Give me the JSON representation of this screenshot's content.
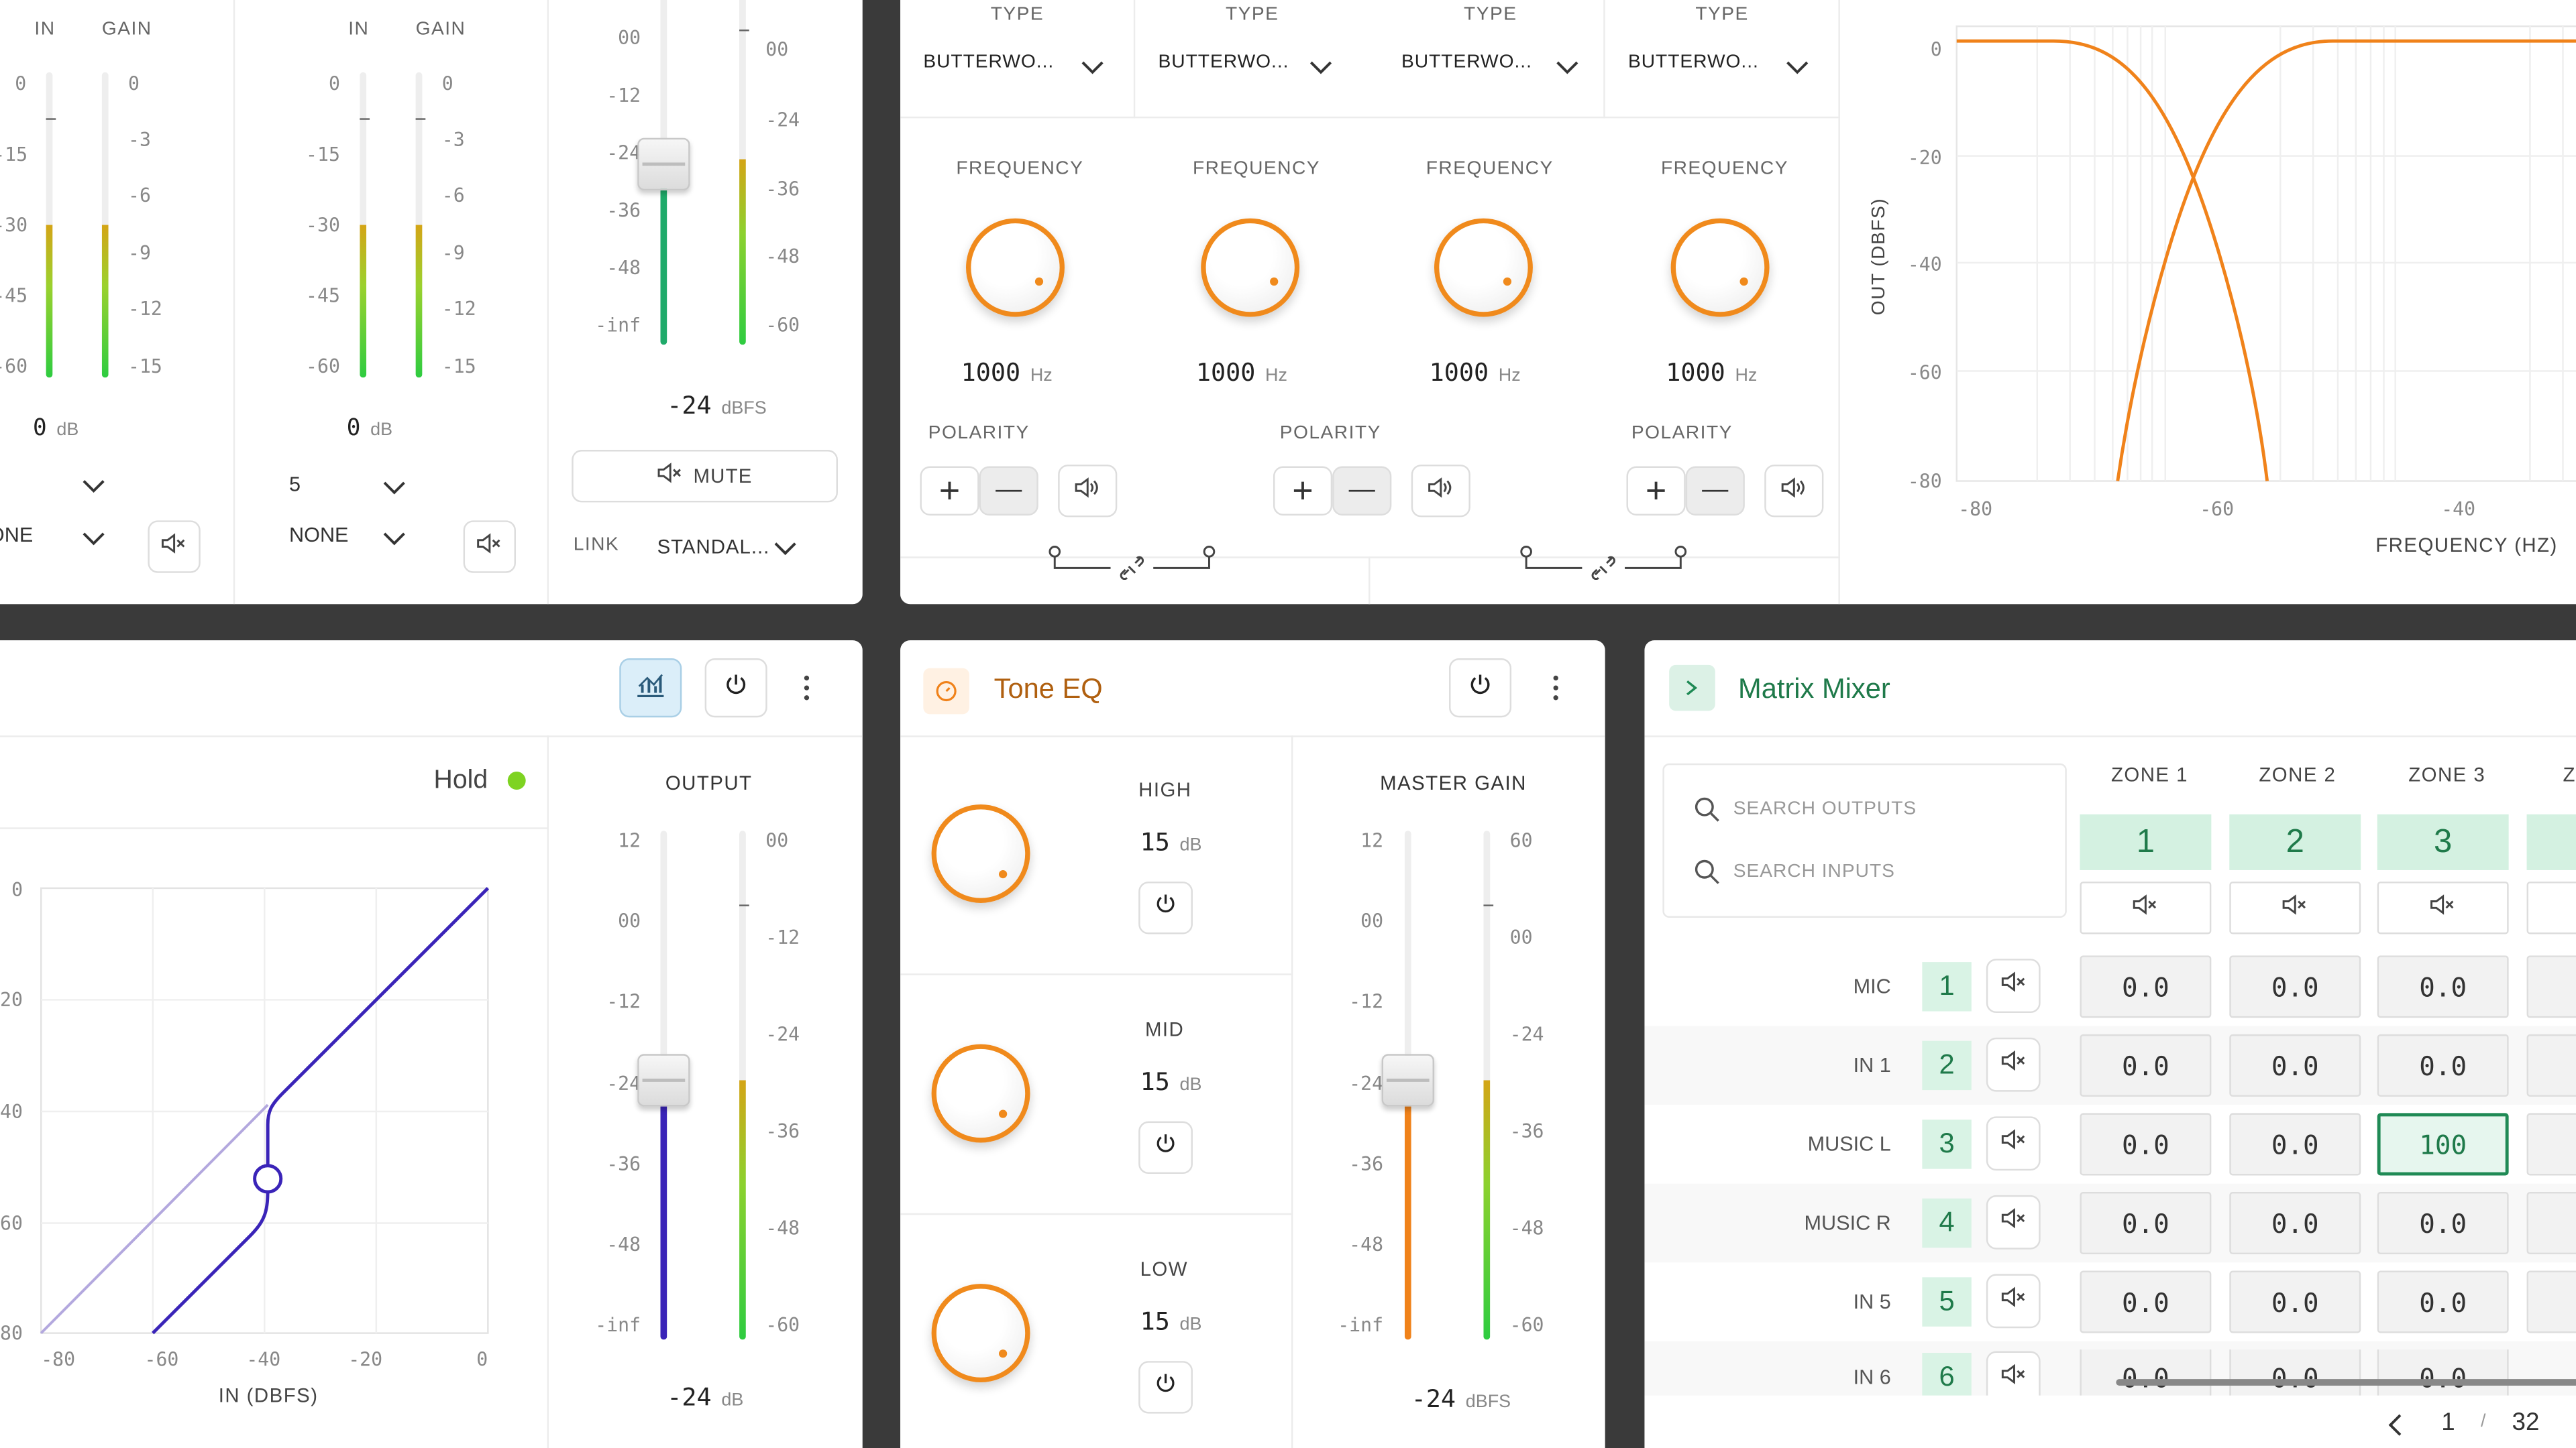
{
  "input_panel": {
    "ch1": {
      "in_label": "IN",
      "gain_label": "GAIN",
      "in_ticks": [
        "0",
        "-15",
        "-30",
        "-45",
        "-60"
      ],
      "gain_ticks": [
        "0",
        "-3",
        "-6",
        "-9",
        "-12",
        "-15"
      ],
      "db_value": "0",
      "db_unit": "dB",
      "dropdown_value": "",
      "mode_value": "NONE"
    },
    "ch2": {
      "in_label": "IN",
      "gain_label": "GAIN",
      "in_ticks": [
        "0",
        "-15",
        "-30",
        "-45",
        "-60"
      ],
      "gain_ticks": [
        "0",
        "-3",
        "-6",
        "-9",
        "-12",
        "-15"
      ],
      "db_value": "0",
      "db_unit": "dB",
      "dropdown_value": "5",
      "mode_value": "NONE"
    },
    "fader": {
      "left_ticks": [
        "00",
        "-12",
        "-24",
        "-36",
        "-48",
        "-inf"
      ],
      "right_ticks": [
        "00",
        "-24",
        "-36",
        "-48",
        "-60"
      ],
      "value": "-24",
      "unit": "dBFS",
      "mute_label": "MUTE",
      "link_label": "LINK",
      "link_value": "STANDAL..."
    }
  },
  "crossover_panel": {
    "bands": [
      {
        "type_label": "TYPE",
        "type_value": "BUTTERWO...",
        "freq_label": "FREQUENCY",
        "freq_value": "1000",
        "freq_unit": "Hz",
        "polarity_label": "POLARITY"
      },
      {
        "type_label": "TYPE",
        "type_value": "BUTTERWO...",
        "freq_label": "FREQUENCY",
        "freq_value": "1000",
        "freq_unit": "Hz",
        "polarity_label": "POLARITY"
      },
      {
        "type_label": "TYPE",
        "type_value": "BUTTERWO...",
        "freq_label": "FREQUENCY",
        "freq_value": "1000",
        "freq_unit": "Hz",
        "polarity_label": ""
      },
      {
        "type_label": "TYPE",
        "type_value": "BUTTERWO...",
        "freq_label": "FREQUENCY",
        "freq_value": "1000",
        "freq_unit": "Hz",
        "polarity_label": "POLARITY"
      }
    ],
    "plus_symbol": "+",
    "minus_symbol": "—"
  },
  "response_chart": {
    "ylabel": "OUT (DBFS)",
    "xlabel": "FREQUENCY (HZ)",
    "yticks": [
      "0",
      "-20",
      "-40",
      "-60",
      "-80"
    ],
    "xticks": [
      "-80",
      "-60",
      "-40"
    ],
    "accent": "#f0821a"
  },
  "compressor_panel": {
    "hold_label": "Hold",
    "hold_color": "#7ed321",
    "xlabel": "IN (DBFS)",
    "xticks": [
      "-80",
      "-60",
      "-40",
      "-20",
      "0"
    ],
    "yticks": [
      "0",
      "20",
      "40",
      "60",
      "80"
    ],
    "output_label": "OUTPUT",
    "out_left_ticks": [
      "12",
      "00",
      "-12",
      "-24",
      "-36",
      "-48",
      "-inf"
    ],
    "out_right_ticks": [
      "00",
      "-12",
      "-24",
      "-36",
      "-48",
      "-60"
    ],
    "out_value": "-24",
    "out_unit": "dB",
    "accent": "#3a24b8"
  },
  "tone_eq_panel": {
    "title": "Tone EQ",
    "bands": [
      {
        "label": "HIGH",
        "value": "15",
        "unit": "dB"
      },
      {
        "label": "MID",
        "value": "15",
        "unit": "dB"
      },
      {
        "label": "LOW",
        "value": "15",
        "unit": "dB"
      }
    ],
    "master_label": "MASTER GAIN",
    "left_ticks": [
      "12",
      "00",
      "-12",
      "-24",
      "-36",
      "-48",
      "-inf"
    ],
    "right_ticks": [
      "60",
      "00",
      "-24",
      "-36",
      "-48",
      "-60"
    ],
    "value": "-24",
    "unit": "dBFS",
    "accent": "#f0821a"
  },
  "matrix_panel": {
    "title": "Matrix Mixer",
    "search_outputs": "SEARCH OUTPUTS",
    "search_inputs": "SEARCH INPUTS",
    "zones": [
      {
        "label": "ZONE 1",
        "num": "1"
      },
      {
        "label": "ZONE 2",
        "num": "2"
      },
      {
        "label": "ZONE 3",
        "num": "3"
      }
    ],
    "zone4_partial": "Z",
    "rows": [
      {
        "label": "MIC",
        "num": "1",
        "cells": [
          "0.0",
          "0.0",
          "0.0"
        ]
      },
      {
        "label": "IN 1",
        "num": "2",
        "cells": [
          "0.0",
          "0.0",
          "0.0"
        ]
      },
      {
        "label": "MUSIC L",
        "num": "3",
        "cells": [
          "0.0",
          "0.0",
          "100"
        ]
      },
      {
        "label": "MUSIC R",
        "num": "4",
        "cells": [
          "0.0",
          "0.0",
          "0.0"
        ]
      },
      {
        "label": "IN 5",
        "num": "5",
        "cells": [
          "0.0",
          "0.0",
          "0.0"
        ]
      },
      {
        "label": "IN 6",
        "num": "6",
        "cells": [
          "0.0",
          "0.0",
          "0.0"
        ]
      }
    ],
    "page_current": "1",
    "page_sep": "/",
    "page_total": "32",
    "accent": "#1f8a55"
  }
}
